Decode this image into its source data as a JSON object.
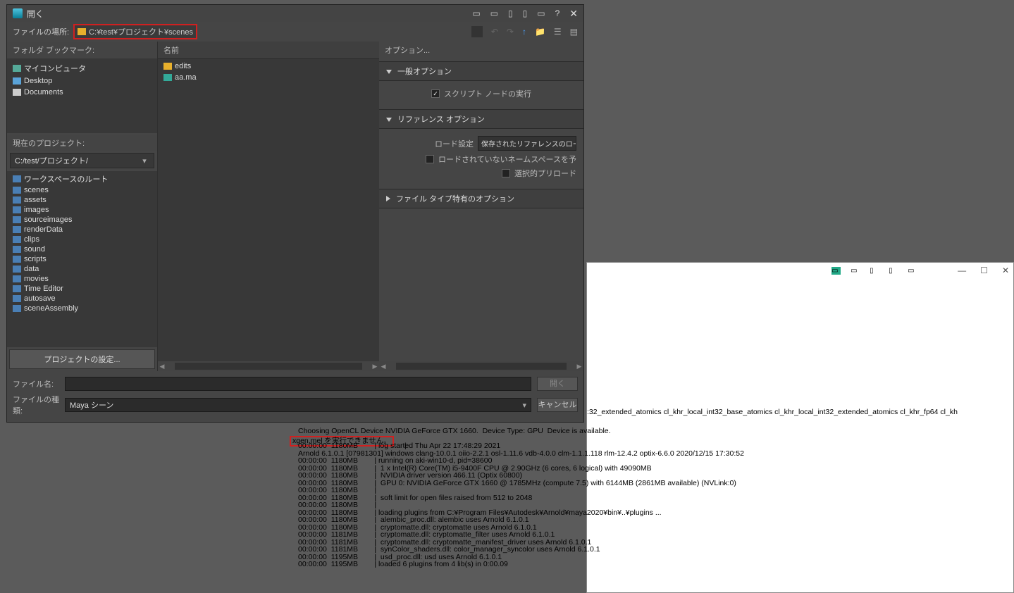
{
  "dialog": {
    "title": "開く",
    "pathLabel": "ファイルの場所:",
    "path": "C:¥test¥プロジェクト¥scenes",
    "bookmarksHeader": "フォルダ ブックマーク:",
    "bookmarks": [
      "マイコンピュータ",
      "Desktop",
      "Documents"
    ],
    "projectHeader": "現在のプロジェクト:",
    "projectPath": "C:/test/プロジェクト/",
    "workspace": [
      "ワークスペースのルート",
      "scenes",
      "assets",
      "images",
      "sourceimages",
      "renderData",
      "clips",
      "sound",
      "scripts",
      "data",
      "movies",
      "Time Editor",
      "autosave",
      "sceneAssembly"
    ],
    "projectSettings": "プロジェクトの設定...",
    "nameHeader": "名前",
    "files": [
      {
        "name": "edits",
        "type": "folder"
      },
      {
        "name": "aa.ma",
        "type": "ma"
      }
    ],
    "optionsHeader": "オプション...",
    "expGeneral": "一般オプション",
    "cbScript": "スクリプト ノードの実行",
    "expRef": "リファレンス オプション",
    "loadLabel": "ロード設定",
    "loadValue": "保存されたリファレンスのロード状態をロー",
    "cbNs": "ロードされていないネームスペースを予",
    "cbPre": "選択的プリロード",
    "expFiletype": "ファイル タイプ特有のオプション",
    "fileName": "ファイル名:",
    "fileType": "ファイルの種類:",
    "fileTypeValue": "Maya シーン",
    "btnOpen": "開く",
    "btnCancel": "キャンセル"
  },
  "console": {
    "line_ext": ":32_extended_atomics cl_khr_local_int32_base_atomics cl_khr_local_int32_extended_atomics cl_khr_fp64 cl_kh",
    "line1": "Choosing OpenCL Device NVIDIA GeForce GTX 1660.  Device Type: GPU  Device is available.",
    "err": "xgen.mel を実行できません。",
    "rest": "00:00:00  1180MB        | log started Thu Apr 22 17:48:29 2021\nArnold 6.1.0.1 [07981301] windows clang-10.0.1 oiio-2.2.1 osl-1.11.6 vdb-4.0.0 clm-1.1.1.118 rlm-12.4.2 optix-6.6.0 2020/12/15 17:30:52\n00:00:00  1180MB        | running on aki-win10-d, pid=38600\n00:00:00  1180MB        |  1 x Intel(R) Core(TM) i5-9400F CPU @ 2.90GHz (6 cores, 6 logical) with 49090MB\n00:00:00  1180MB        |  NVIDIA driver version 466.11 (Optix 60800)\n00:00:00  1180MB        |  GPU 0: NVIDIA GeForce GTX 1660 @ 1785MHz (compute 7.5) with 6144MB (2861MB available) (NVLink:0)\n00:00:00  1180MB        |\n00:00:00  1180MB        |  soft limit for open files raised from 512 to 2048\n00:00:00  1180MB        |\n00:00:00  1180MB        | loading plugins from C:¥Program Files¥Autodesk¥Arnold¥maya2020¥bin¥..¥plugins ...\n00:00:00  1180MB        |  alembic_proc.dll: alembic uses Arnold 6.1.0.1\n00:00:00  1180MB        |  cryptomatte.dll: cryptomatte uses Arnold 6.1.0.1\n00:00:00  1181MB        |  cryptomatte.dll: cryptomatte_filter uses Arnold 6.1.0.1\n00:00:00  1181MB        |  cryptomatte.dll: cryptomatte_manifest_driver uses Arnold 6.1.0.1\n00:00:00  1181MB        |  synColor_shaders.dll: color_manager_syncolor uses Arnold 6.1.0.1\n00:00:00  1195MB        |  usd_proc.dll: usd uses Arnold 6.1.0.1\n00:00:00  1195MB        | loaded 6 plugins from 4 lib(s) in 0:00.09"
  }
}
